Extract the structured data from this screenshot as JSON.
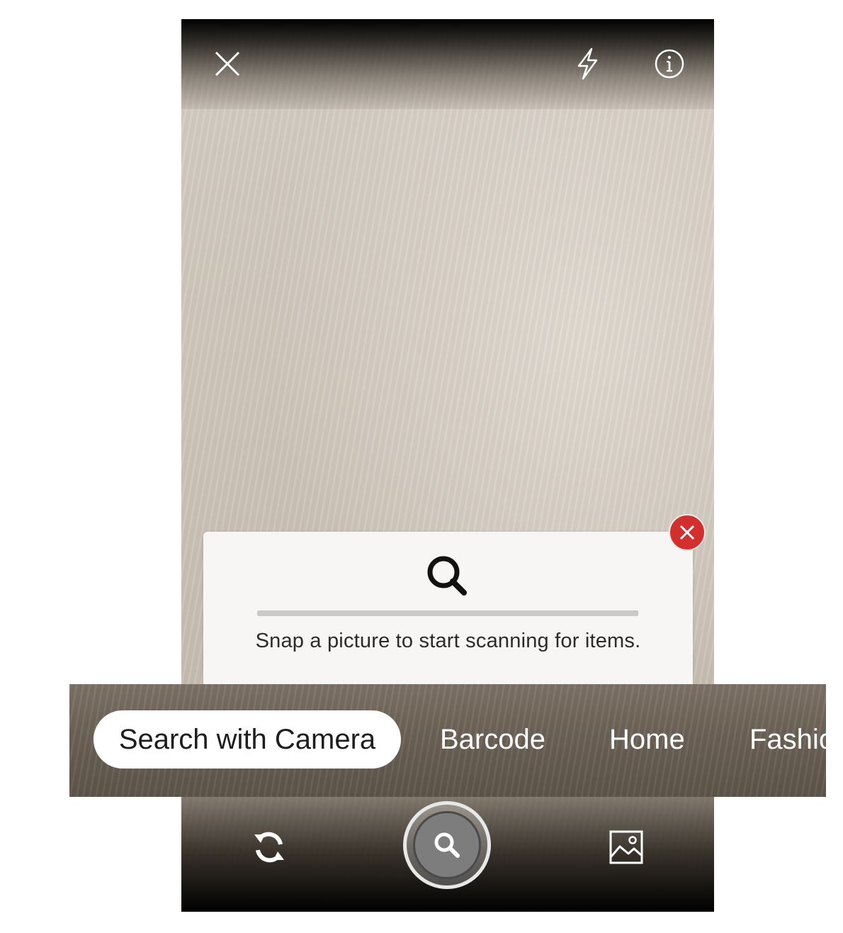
{
  "top_bar": {
    "close_icon": "close-icon",
    "flash_icon": "flash-icon",
    "info_icon": "info-icon"
  },
  "hint_card": {
    "icon": "search-icon",
    "progress": 0,
    "text": "Snap a picture to start scanning for items.",
    "dismiss_icon": "close-icon",
    "dismiss_color": "#d32f2f"
  },
  "mode_tabs": {
    "active": "Search with Camera",
    "items": [
      "Search with Camera",
      "Barcode",
      "Home",
      "Fashion"
    ]
  },
  "bottom_bar": {
    "flip_icon": "camera-flip-icon",
    "shutter_icon": "search-icon",
    "gallery_icon": "gallery-icon"
  }
}
